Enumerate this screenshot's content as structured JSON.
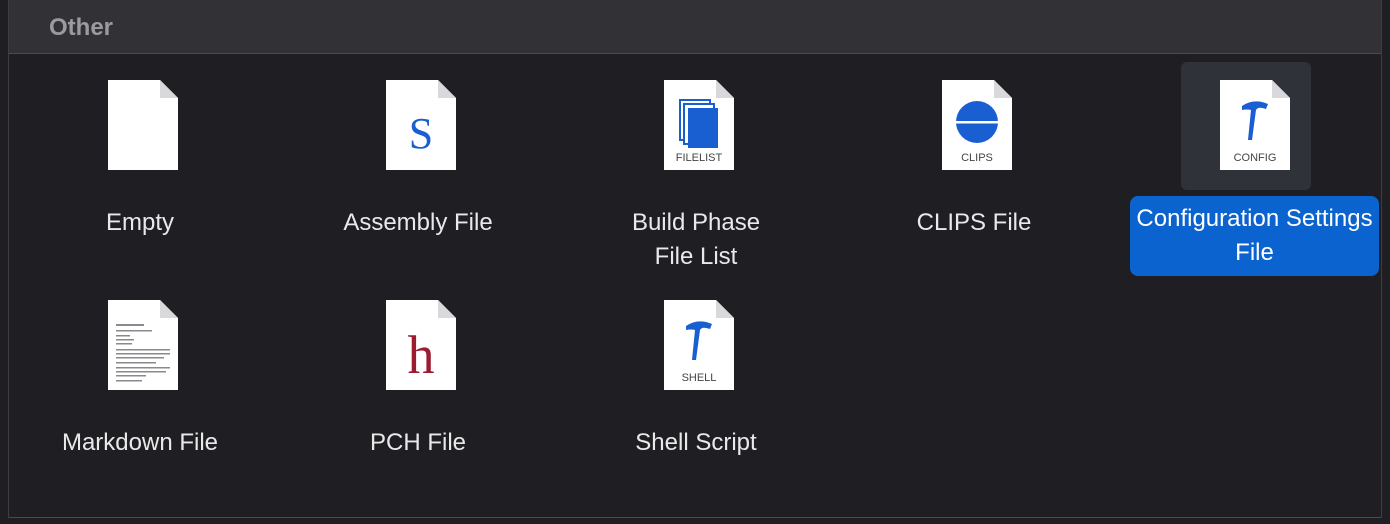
{
  "section": {
    "title": "Other"
  },
  "templates": [
    {
      "label": "Empty",
      "badge": "",
      "glyph": ""
    },
    {
      "label": "Assembly File",
      "badge": "",
      "glyph": "S"
    },
    {
      "label": "Build Phase File List",
      "badge": "FILELIST",
      "glyph": ""
    },
    {
      "label": "CLIPS File",
      "badge": "CLIPS",
      "glyph": ""
    },
    {
      "label": "Configuration Settings File",
      "badge": "CONFIG",
      "glyph": ""
    },
    {
      "label": "Markdown File",
      "badge": "",
      "glyph": ""
    },
    {
      "label": "PCH File",
      "badge": "",
      "glyph": "h"
    },
    {
      "label": "Shell Script",
      "badge": "SHELL",
      "glyph": ""
    }
  ],
  "colors": {
    "selection": "#0b63cf",
    "icon_blue": "#1a5fd1",
    "pch_red": "#9b1b30"
  }
}
